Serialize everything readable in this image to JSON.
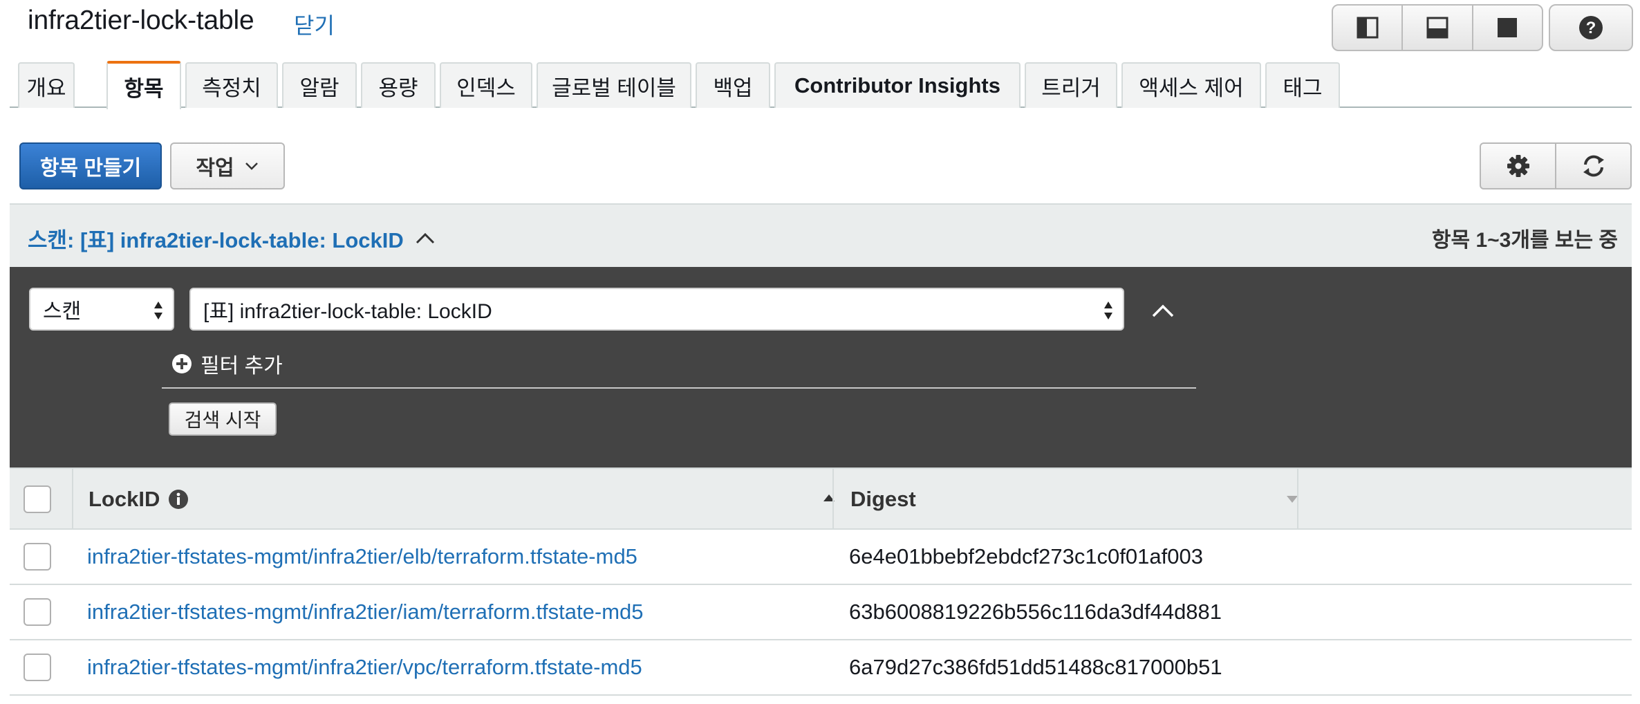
{
  "header": {
    "title": "infra2tier-lock-table",
    "close_label": "닫기",
    "layout_icons": [
      "split-vertical-icon",
      "split-horizontal-icon",
      "full-panel-icon"
    ],
    "help_icon": "help-icon"
  },
  "tabs": [
    {
      "label": "개요",
      "active": false
    },
    {
      "label": "항목",
      "active": true
    },
    {
      "label": "측정치",
      "active": false
    },
    {
      "label": "알람",
      "active": false
    },
    {
      "label": "용량",
      "active": false
    },
    {
      "label": "인덱스",
      "active": false
    },
    {
      "label": "글로벌 테이블",
      "active": false
    },
    {
      "label": "백업",
      "active": false
    },
    {
      "label": "Contributor Insights",
      "active": false
    },
    {
      "label": "트리거",
      "active": false
    },
    {
      "label": "액세스 제어",
      "active": false
    },
    {
      "label": "태그",
      "active": false
    }
  ],
  "toolbar": {
    "create_label": "항목 만들기",
    "actions_label": "작업",
    "settings_icon": "gear-icon",
    "refresh_icon": "refresh-icon"
  },
  "scan": {
    "title": "스캔: [표] infra2tier-lock-table: LockID",
    "item_count": "항목 1~3개를 보는 중"
  },
  "filter": {
    "mode_value": "스캔",
    "source_value": "[표] infra2tier-lock-table: LockID",
    "add_filter_label": "필터 추가",
    "search_label": "검색 시작"
  },
  "table": {
    "columns": [
      "LockID",
      "Digest"
    ],
    "rows": [
      {
        "lockid": "infra2tier-tfstates-mgmt/infra2tier/elb/terraform.tfstate-md5",
        "digest": "6e4e01bbebf2ebdcf273c1c0f01af003"
      },
      {
        "lockid": "infra2tier-tfstates-mgmt/infra2tier/iam/terraform.tfstate-md5",
        "digest": "63b6008819226b556c116da3df44d881"
      },
      {
        "lockid": "infra2tier-tfstates-mgmt/infra2tier/vpc/terraform.tfstate-md5",
        "digest": "6a79d27c386fd51dd51488c817000b51"
      }
    ]
  },
  "colors": {
    "accent_link": "#1f6fb5",
    "primary_button": "#2a70c2",
    "active_tab_border": "#ec7211",
    "filter_panel_bg": "#444444"
  }
}
